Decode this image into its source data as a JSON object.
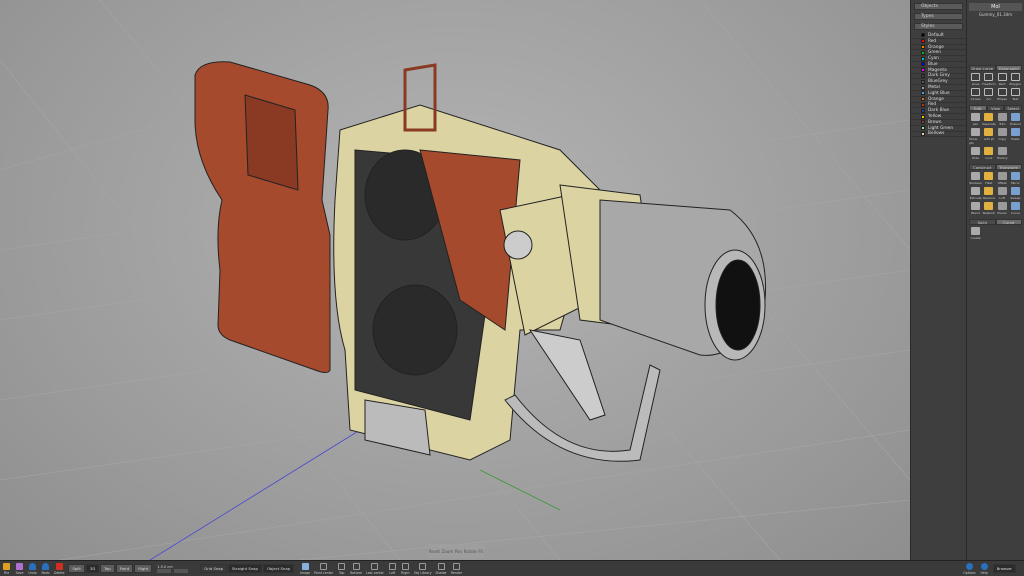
{
  "app": {
    "title": "MoI",
    "filename": "Gummy_01.3dm"
  },
  "left_panel": {
    "objects": "Objects",
    "types": "Types",
    "styles": "Styles",
    "style_items": [
      {
        "name": "Default",
        "color": "#000000"
      },
      {
        "name": "Red",
        "color": "#ff0000"
      },
      {
        "name": "Orange",
        "color": "#ff8000"
      },
      {
        "name": "Green",
        "color": "#00c000"
      },
      {
        "name": "Cyan",
        "color": "#00c0c0"
      },
      {
        "name": "Blue",
        "color": "#0000ff"
      },
      {
        "name": "Magenta",
        "color": "#ff00ff"
      },
      {
        "name": "Dark Grey",
        "color": "#404040"
      },
      {
        "name": "BlueGrey",
        "color": "#505070"
      },
      {
        "name": "Metal",
        "color": "#a0a0a0"
      },
      {
        "name": "Light Blue",
        "color": "#40a0e0"
      },
      {
        "name": "Orange",
        "color": "#d07020"
      },
      {
        "name": "Red",
        "color": "#c03020"
      },
      {
        "name": "Dark Blue",
        "color": "#2040a0"
      },
      {
        "name": "Yellow",
        "color": "#f0c000"
      },
      {
        "name": "Brown",
        "color": "#8a4030"
      },
      {
        "name": "Light Green",
        "color": "#90e0a0"
      },
      {
        "name": "Bellows",
        "color": "#e0d8a0"
      }
    ]
  },
  "right_panel": {
    "draw_tabs": [
      "Draw curve",
      "Draw solid"
    ],
    "draw_tools": [
      "Lines",
      "Freeform",
      "Rect",
      "Polygon",
      "Circles",
      "Arc",
      "Ellipse",
      "Text"
    ],
    "edit_tabs": [
      "Edit",
      "View",
      "Select"
    ],
    "edit_tools": [
      "Join",
      "Separate",
      "Trim",
      "Extend",
      "Show pts",
      "Add pt",
      "Copy",
      "Paste",
      "Hide",
      "Lock",
      "History"
    ],
    "construct_tabs": [
      "Construct",
      "Transform"
    ],
    "construct_tools": [
      "Boolean",
      "Fillet",
      "Offset",
      "Mirror",
      "Extrude",
      "Revolve",
      "Loft",
      "Sweep",
      "Blend",
      "Network",
      "Planar",
      "Curve"
    ],
    "solid_tabs": [
      "Solid",
      "Curve"
    ],
    "solid_tools": [
      "Create"
    ]
  },
  "bottom": {
    "file": "File",
    "save": "Save",
    "undo": "Undo",
    "redo": "Redo",
    "delete": "Delete",
    "views": [
      "Split",
      "3D",
      "Top",
      "Front",
      "Right"
    ],
    "coords": "1.5.0 cm",
    "grid_snap": "Grid Snap",
    "straight_snap": "Straight Snap",
    "object_snap": "Object Snap",
    "tools": [
      "Image",
      "Point center",
      "Top",
      "Bottom",
      "Last center",
      "Left",
      "Right",
      "Obj Library",
      "Shader",
      "Render"
    ],
    "options": "Options",
    "help": "Help",
    "browser": "Browser"
  },
  "viewport_nav": [
    "Reset",
    "Zoom",
    "Pan",
    "Rotate",
    "Fit"
  ]
}
